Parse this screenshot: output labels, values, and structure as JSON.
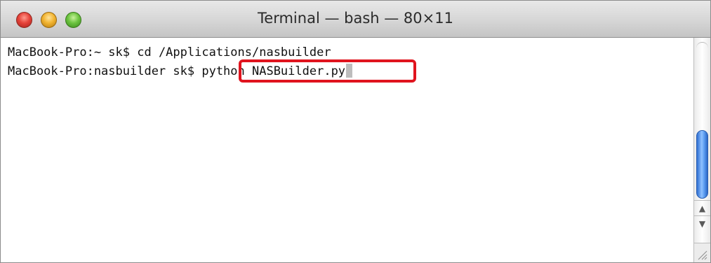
{
  "window": {
    "title": "Terminal — bash — 80×11"
  },
  "terminal": {
    "lines": [
      {
        "prompt": "MacBook-Pro:~ sk$ ",
        "command": "cd /Applications/nasbuilder"
      },
      {
        "prompt": "MacBook-Pro:nasbuilder sk$ ",
        "command": "python NASBuilder.py"
      }
    ]
  },
  "colors": {
    "highlight": "#e0141e",
    "scroll_thumb": "#4f8fe8"
  },
  "icons": {
    "close": "close-button-icon",
    "minimize": "minimize-button-icon",
    "zoom": "zoom-button-icon",
    "scroll_up": "arrow-up-icon",
    "scroll_down": "arrow-down-icon",
    "resize": "resize-grip-icon"
  }
}
